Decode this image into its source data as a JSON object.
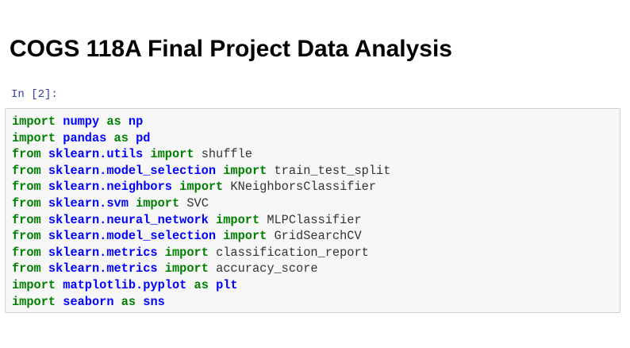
{
  "title": "COGS 118A Final Project Data Analysis",
  "cell": {
    "prompt": "In [2]:",
    "lines": [
      {
        "kw1": "import",
        "module": "numpy",
        "kw2": "as",
        "name": "np"
      },
      {
        "kw1": "import",
        "module": "pandas",
        "kw2": "as",
        "name": "pd"
      },
      {
        "kw1": "from",
        "module": "sklearn.utils",
        "kw2": "import",
        "name": "shuffle"
      },
      {
        "kw1": "from",
        "module": "sklearn.model_selection",
        "kw2": "import",
        "name": "train_test_split"
      },
      {
        "kw1": "from",
        "module": "sklearn.neighbors",
        "kw2": "import",
        "name": "KNeighborsClassifier"
      },
      {
        "kw1": "from",
        "module": "sklearn.svm",
        "kw2": "import",
        "name": "SVC"
      },
      {
        "kw1": "from",
        "module": "sklearn.neural_network",
        "kw2": "import",
        "name": "MLPClassifier"
      },
      {
        "kw1": "from",
        "module": "sklearn.model_selection",
        "kw2": "import",
        "name": "GridSearchCV"
      },
      {
        "kw1": "from",
        "module": "sklearn.metrics",
        "kw2": "import",
        "name": "classification_report"
      },
      {
        "kw1": "from",
        "module": "sklearn.metrics",
        "kw2": "import",
        "name": "accuracy_score"
      },
      {
        "kw1": "import",
        "module": "matplotlib.pyplot",
        "kw2": "as",
        "name": "plt"
      },
      {
        "kw1": "import",
        "module": "seaborn",
        "kw2": "as",
        "name": "sns"
      }
    ]
  },
  "colors": {
    "keyword": "#008000",
    "module": "#0000ff",
    "name_bound": "#0000ff",
    "name_plain": "#333333",
    "prompt": "#303f9f",
    "cell_background": "#f7f7f7",
    "cell_border": "#cfcfcf"
  }
}
